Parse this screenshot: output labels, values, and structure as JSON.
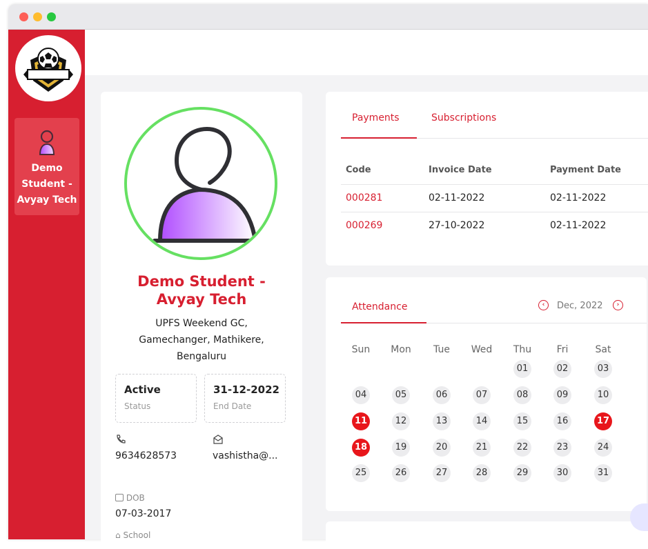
{
  "window": {
    "controls": [
      "close",
      "minimize",
      "zoom"
    ]
  },
  "sidebar": {
    "logo_icon": "football-crest-icon",
    "items": [
      {
        "icon": "user-icon",
        "label_line1": "Demo",
        "label_line2": "Student -",
        "label_line3": "Avyay Tech"
      }
    ]
  },
  "profile": {
    "name_line1": "Demo Student -",
    "name_line2": "Avyay Tech",
    "address_line1": "UPFS Weekend GC,",
    "address_line2": "Gamechanger, Mathikere,",
    "address_line3": "Bengaluru",
    "status_value": "Active",
    "status_label": "Status",
    "end_date_value": "31-12-2022",
    "end_date_label": "End Date",
    "phone": "9634628573",
    "email": "vashistha@...",
    "dob_label": "DOB",
    "dob_value": "07-03-2017",
    "school_label": "School"
  },
  "payments": {
    "tabs": [
      "Payments",
      "Subscriptions"
    ],
    "columns": [
      "Code",
      "Invoice Date",
      "Payment Date"
    ],
    "rows": [
      {
        "code": "000281",
        "invoice_date": "02-11-2022",
        "payment_date": "02-11-2022"
      },
      {
        "code": "000269",
        "invoice_date": "27-10-2022",
        "payment_date": "02-11-2022"
      }
    ]
  },
  "attendance": {
    "tab": "Attendance",
    "month": "Dec, 2022",
    "weekdays": [
      "Sun",
      "Mon",
      "Tue",
      "Wed",
      "Thu",
      "Fri",
      "Sat"
    ],
    "highlight_color": "#e8161b",
    "highlighted_days": [
      "11",
      "17",
      "18"
    ]
  },
  "colors": {
    "brand": "#d71f30",
    "accent_green": "#66e062"
  }
}
